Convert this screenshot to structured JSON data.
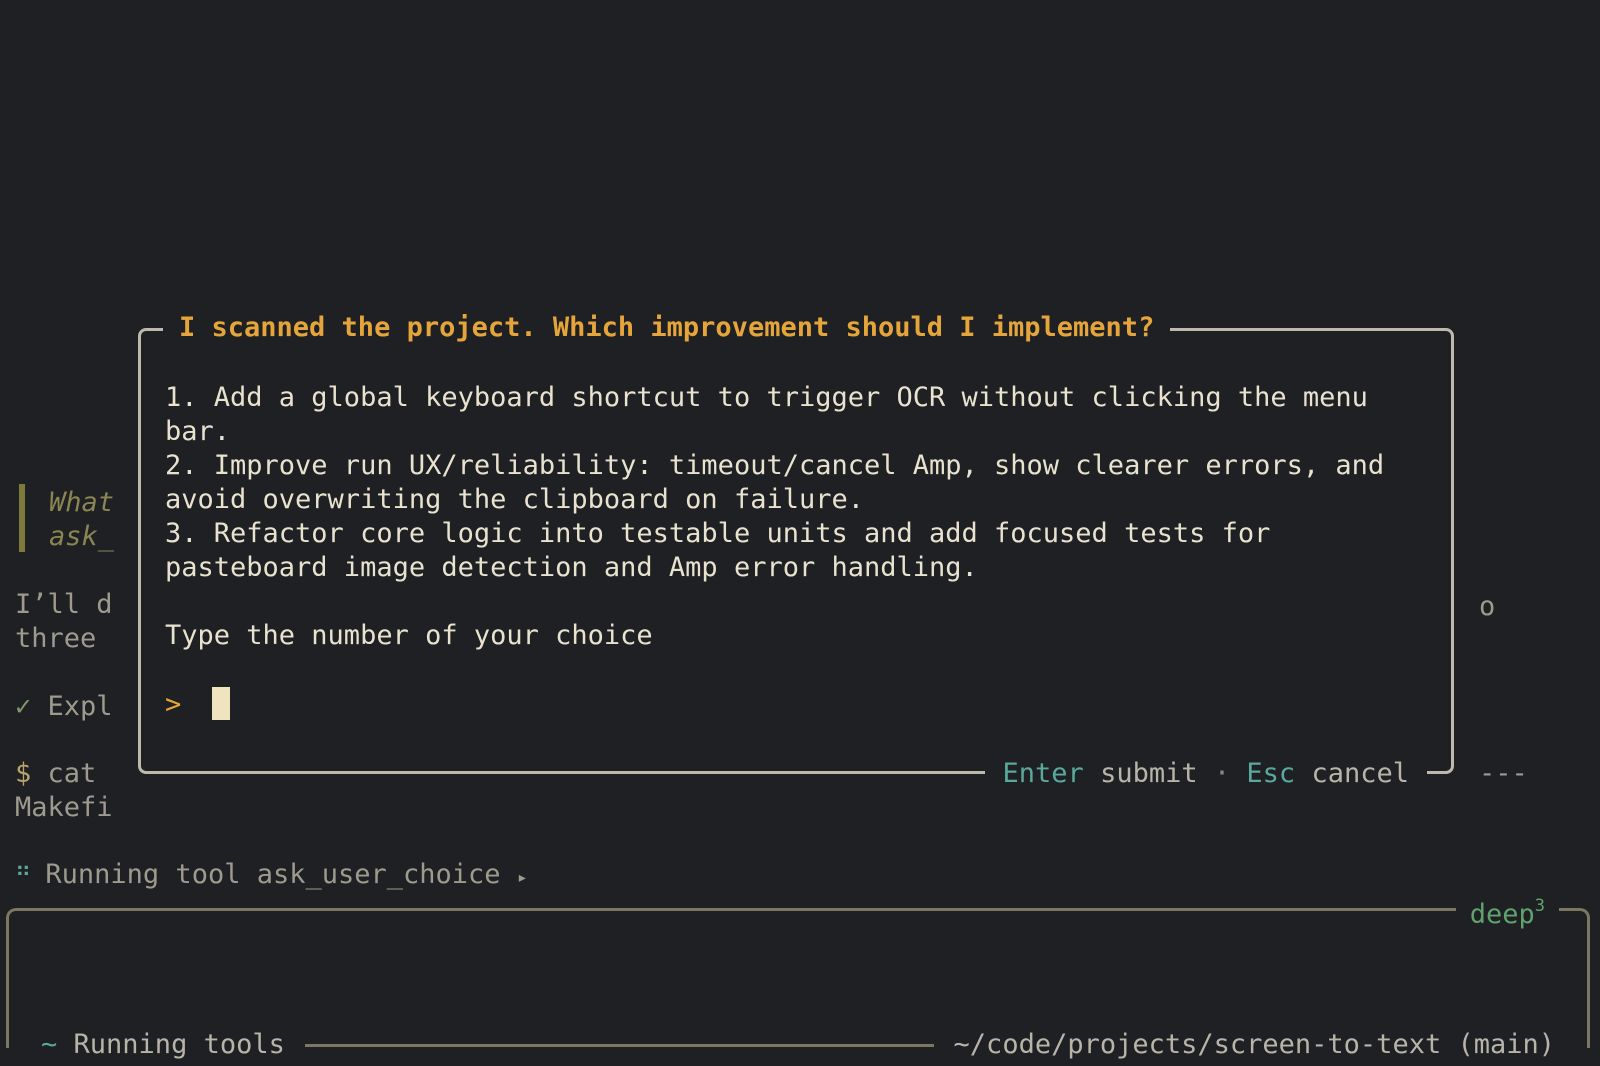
{
  "background": {
    "quote_lines": [
      "What",
      "ask_"
    ],
    "message_lines": [
      "I’ll d",
      "three"
    ],
    "check_mark": "✓",
    "check_text": "Expl",
    "dollar": "$",
    "command_text": "cat",
    "command_output": "Makefi",
    "right_fragment_1": "o",
    "right_fragment_2": "---",
    "spinner_glyph": "⠛",
    "running_tool": "Running tool ask_user_choice",
    "running_tool_arrow": "▸"
  },
  "dialog": {
    "title": "I scanned the project. Which improvement should I implement?",
    "options": [
      "1. Add a global keyboard shortcut to trigger OCR without clicking the menu bar.",
      "2. Improve run UX/reliability: timeout/cancel Amp, show clearer errors, and avoid overwriting the clipboard on failure.",
      "3. Refactor core logic into testable units and add focused tests for pasteboard image detection and Amp error handling."
    ],
    "instruction": "Type the number of your choice",
    "prompt_symbol": ">",
    "input_value": "",
    "footer": {
      "enter_key": "Enter",
      "enter_label": "submit",
      "separator": "·",
      "esc_key": "Esc",
      "esc_label": "cancel"
    }
  },
  "input_panel": {
    "mode": "deep",
    "mode_superscript": "3",
    "status_symbol": "~",
    "status": "Running tools",
    "path": "~/code/projects/screen-to-text (main)"
  },
  "colors": {
    "background": "#1e2023",
    "accent_orange": "#e5a53b",
    "accent_teal": "#5aa99c",
    "accent_green": "#5fa26e",
    "text": "#e8e2cf"
  }
}
